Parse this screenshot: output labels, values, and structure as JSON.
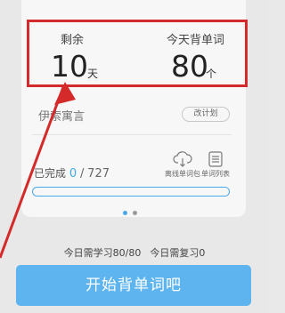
{
  "stats": {
    "remaining_label": "剩余",
    "remaining_value": "10",
    "remaining_unit": "天",
    "today_label": "今天背单词",
    "today_value": "80",
    "today_unit": "个"
  },
  "book": {
    "name": "伊索寓言",
    "plan_button": "改计划"
  },
  "progress": {
    "completed_label": "已完成",
    "completed_value": "0",
    "separator": "/",
    "total_value": "727",
    "fraction": 0.0
  },
  "tools": {
    "offline_label": "离线单词包",
    "list_label": "单词列表"
  },
  "pager": {
    "active_color": "#4aa8e8",
    "inactive_color": "#9a9a9a"
  },
  "summary": {
    "study_text": "今日需学习80/80",
    "review_text": "今日需复习0"
  },
  "start_button": {
    "label": "开始背单词吧"
  },
  "colors": {
    "accent": "#5db4ee",
    "highlight": "#d52a2a"
  }
}
